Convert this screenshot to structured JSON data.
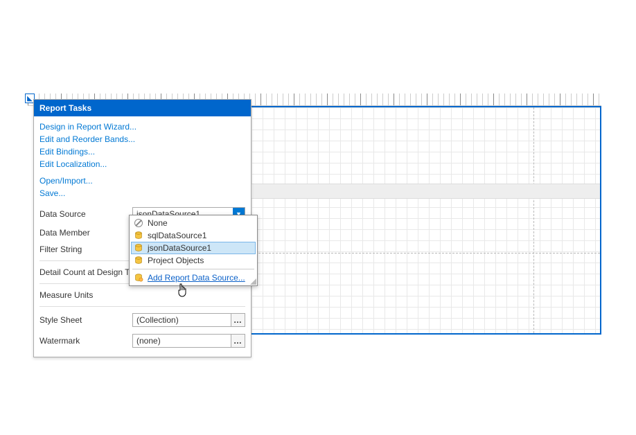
{
  "panel": {
    "title": "Report Tasks",
    "links": {
      "design_wizard": "Design in Report Wizard...",
      "edit_bands": "Edit and Reorder Bands...",
      "edit_bindings": "Edit Bindings...",
      "edit_localization": "Edit Localization...",
      "open_import": "Open/Import...",
      "save": "Save..."
    },
    "props": {
      "data_source_label": "Data Source",
      "data_source_value": "jsonDataSource1",
      "data_member_label": "Data Member",
      "filter_string_label": "Filter String",
      "detail_count_label": "Detail Count at Design Time",
      "measure_units_label": "Measure Units",
      "style_sheet_label": "Style Sheet",
      "style_sheet_value": "(Collection)",
      "watermark_label": "Watermark",
      "watermark_value": "(none)"
    }
  },
  "dropdown": {
    "none": "None",
    "sql": "sqlDataSource1",
    "json": "jsonDataSource1",
    "project": "Project Objects",
    "add": "Add Report Data Source..."
  }
}
